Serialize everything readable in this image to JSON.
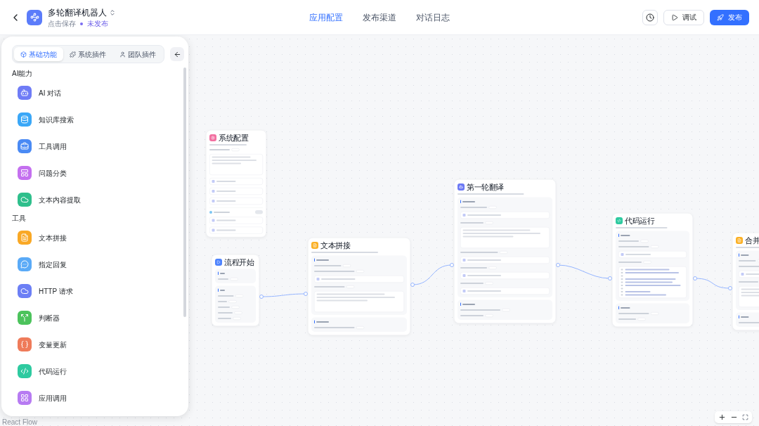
{
  "header": {
    "title": "多轮翻译机器人",
    "save_hint": "点击保存",
    "status": "未发布",
    "tabs": [
      {
        "label": "应用配置",
        "selected": true
      },
      {
        "label": "发布渠道",
        "selected": false
      },
      {
        "label": "对话日志",
        "selected": false
      }
    ],
    "actions": [
      {
        "kind": "history"
      },
      {
        "kind": "outline",
        "label": "调试"
      },
      {
        "kind": "primary",
        "label": "发布"
      }
    ]
  },
  "sidebar": {
    "tabs": [
      {
        "label": "基础功能",
        "selected": true
      },
      {
        "label": "系统插件",
        "selected": false
      },
      {
        "label": "团队插件",
        "selected": false
      }
    ],
    "sections": [
      {
        "title": "AI能力",
        "items": [
          {
            "label": "AI 对话",
            "color": "#6f7cf6"
          },
          {
            "label": "知识库搜索",
            "color": "#3aa7f7"
          },
          {
            "label": "工具调用",
            "color": "#4a8af4"
          },
          {
            "label": "问题分类",
            "color": "#c470ef"
          },
          {
            "label": "文本内容提取",
            "color": "#2fbf8c"
          }
        ]
      },
      {
        "title": "工具",
        "items": [
          {
            "label": "文本拼接",
            "color": "#f9a825"
          },
          {
            "label": "指定回复",
            "color": "#5aaaf7"
          },
          {
            "label": "HTTP 请求",
            "color": "#6c7ff5"
          },
          {
            "label": "判断器",
            "color": "#4cc35c"
          },
          {
            "label": "变量更新",
            "color": "#ef7b5a"
          },
          {
            "label": "代码运行",
            "color": "#2ecaa0"
          },
          {
            "label": "应用调用",
            "color": "#b77bf2"
          }
        ]
      }
    ]
  },
  "canvas": {
    "attribution": "React Flow",
    "nodes": [
      {
        "title": "系统配置",
        "color": "#f26fa0"
      },
      {
        "title": "流程开始",
        "color": "#4e83fd"
      },
      {
        "title": "文本拼接",
        "color": "#fbb024"
      },
      {
        "title": "第一轮翻译",
        "color": "#6b78f5"
      },
      {
        "title": "代码运行",
        "color": "#2ecaa0"
      },
      {
        "title": "合并",
        "color": "#fbb024"
      }
    ]
  }
}
